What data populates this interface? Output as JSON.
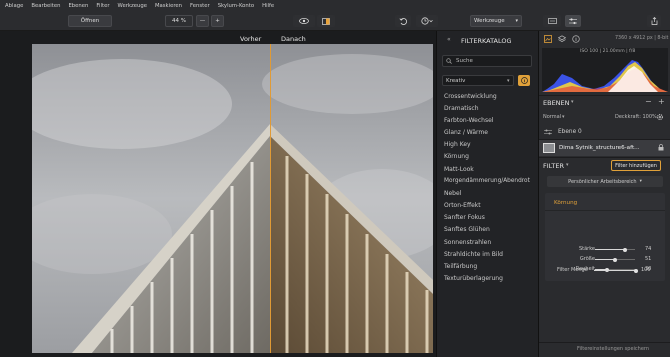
{
  "menu": [
    "Ablage",
    "Bearbeiten",
    "Ebenen",
    "Filter",
    "Werkzeuge",
    "Maskieren",
    "Fenster",
    "Skylum-Konto",
    "Hilfe"
  ],
  "toolbar": {
    "open_label": "Öffnen",
    "zoom_value": "44 %",
    "zoom_minus": "—",
    "zoom_plus": "+",
    "tools_label": "Werkzeuge"
  },
  "compare": {
    "before": "Vorher",
    "after": "Danach"
  },
  "catalog": {
    "title": "FILTERKATALOG",
    "search_placeholder": "Suche",
    "category": "Kreativ",
    "items": [
      "Crossentwicklung",
      "Dramatisch",
      "Farbton-Wechsel",
      "Glanz / Wärme",
      "High Key",
      "Körnung",
      "Matt-Look",
      "Morgendämmerung/Abendrot",
      "Nebel",
      "Orton-Effekt",
      "Sanfter Fokus",
      "Sanftes Glühen",
      "Sonnenstrahlen",
      "Strahldichte im Bild",
      "Teilfärbung",
      "Texturüberlagerung"
    ]
  },
  "info": {
    "dims": "7360 x 4912 px | 8-bit",
    "exif": "ISO 100 | 21.00mm | f/8"
  },
  "layers": {
    "title": "EBENEN",
    "blend_mode": "Normal",
    "opacity": "Deckkraft: 100%",
    "layer0": "Ebene 0",
    "layer1": "Dima Sytnik_structure6-aft..."
  },
  "filter": {
    "title": "FILTER",
    "add_label": "Filter hinzufügen",
    "workspace": "Persönlicher Arbeitsbereich",
    "group": "Körnung",
    "sliders": [
      {
        "label": "Stärke",
        "value": "74",
        "frac": 0.74
      },
      {
        "label": "Größe",
        "value": "51",
        "frac": 0.51
      },
      {
        "label": "Rauheit",
        "value": "30",
        "frac": 0.3
      }
    ],
    "amount_label": "Filter Menge",
    "amount_value": "100",
    "amount_frac": 1.0,
    "save_label": "Filtereinstellungen speichern"
  }
}
